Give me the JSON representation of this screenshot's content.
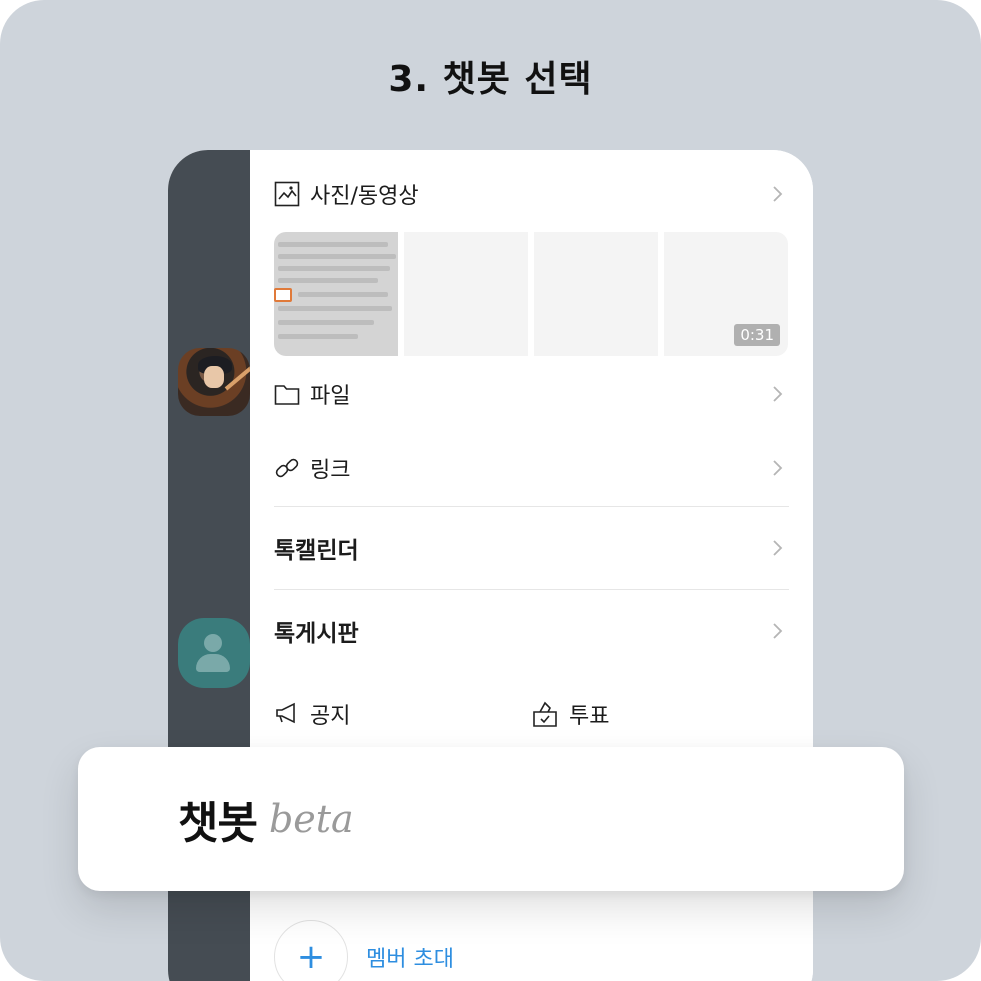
{
  "page": {
    "title": "3. 챗봇 선택"
  },
  "menu": {
    "photos": {
      "label": "사진/동영상",
      "icon": "image-icon"
    },
    "video_duration": "0:31",
    "files": {
      "label": "파일",
      "icon": "folder-icon"
    },
    "links": {
      "label": "링크",
      "icon": "link-icon"
    },
    "calendar": {
      "label": "톡캘린더"
    },
    "board": {
      "label": "톡게시판"
    },
    "notice": {
      "label": "공지",
      "icon": "megaphone-icon"
    },
    "vote": {
      "label": "투표",
      "icon": "ballot-box-icon"
    },
    "invite": {
      "label": "멤버 초대",
      "icon": "plus-icon"
    }
  },
  "popup": {
    "name": "챗봇",
    "tag": "beta"
  },
  "colors": {
    "accent": "#2e8ee0",
    "background": "#ced4db",
    "dim_panel": "#454c53"
  }
}
